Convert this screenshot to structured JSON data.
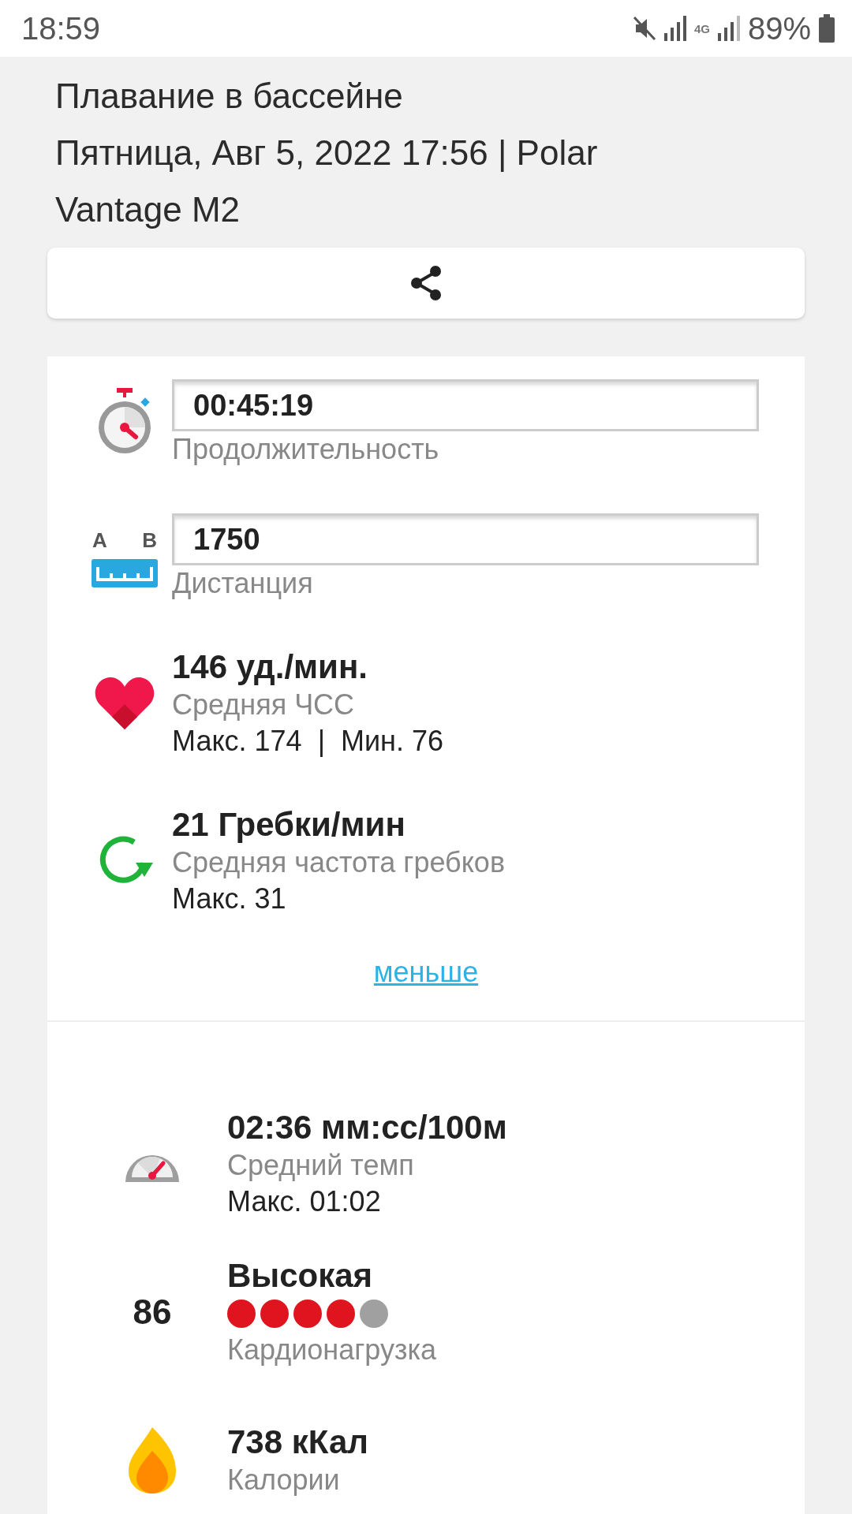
{
  "status_bar": {
    "time": "18:59",
    "network": "4G",
    "battery": "89%"
  },
  "header": {
    "title": "Плавание в бассейне",
    "subtitle": "Пятница, Авг 5, 2022 17:56 | Polar Vantage M2"
  },
  "summary": [
    {
      "kind": "duration",
      "value": "00:45:19",
      "label": "Продолжительность"
    },
    {
      "kind": "distance",
      "icon_letters": [
        "A",
        "B"
      ],
      "value": "1750",
      "label": "Дистанция"
    },
    {
      "kind": "heart_rate",
      "value": "146 уд./мин.",
      "label": "Средняя ЧСС",
      "detail": "Макс. 174  |  Мин. 76"
    },
    {
      "kind": "stroke_rate",
      "value": "21 Гребки/мин",
      "label": "Средняя частота гребков",
      "detail": "Макс. 31"
    }
  ],
  "toggle_link": "меньше",
  "details": [
    {
      "kind": "pace",
      "value": "02:36 мм:сс/100м",
      "label": "Средний темп",
      "detail": "Макс. 01:02"
    },
    {
      "kind": "cardio_load",
      "score": "86",
      "value": "Высокая",
      "stars": 4,
      "label": "Кардионагрузка"
    },
    {
      "kind": "calories",
      "value": "738 кКал",
      "label": "Калории"
    }
  ]
}
